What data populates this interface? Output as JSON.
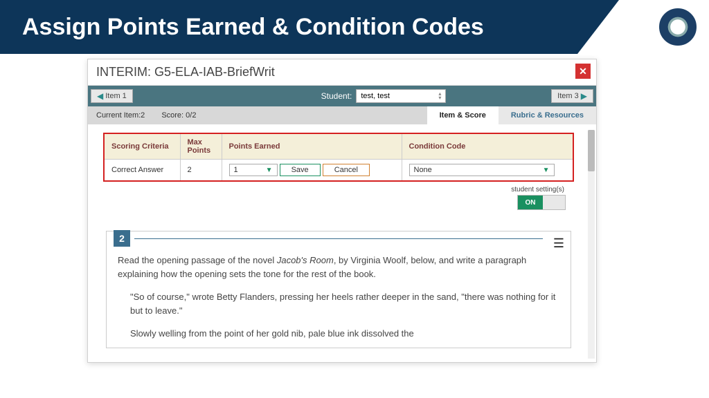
{
  "slide": {
    "title": "Assign Points Earned & Condition Codes"
  },
  "panel": {
    "title": "INTERIM: G5-ELA-IAB-BriefWrit",
    "close": "✕"
  },
  "nav": {
    "prev": "Item 1",
    "next": "Item 3",
    "studentLabel": "Student:",
    "studentValue": "test, test"
  },
  "info": {
    "currentItem": "Current Item:2",
    "score": "Score: 0/2"
  },
  "tabs": {
    "active": "Item & Score",
    "inactive": "Rubric & Resources"
  },
  "table": {
    "headers": {
      "criteria": "Scoring Criteria",
      "max": "Max Points",
      "earned": "Points Earned",
      "condition": "Condition Code"
    },
    "row": {
      "criteria": "Correct Answer",
      "max": "2",
      "earned": "1",
      "save": "Save",
      "cancel": "Cancel",
      "condition": "None"
    }
  },
  "settings": {
    "label": "student setting(s)",
    "on": "ON"
  },
  "item": {
    "num": "2",
    "para1a": "Read the opening passage of the novel ",
    "para1b": "Jacob's Room",
    "para1c": ", by Virginia Woolf, below, and write a paragraph explaining how the opening sets the tone for the rest of the book.",
    "quote": "\"So of course,\" wrote Betty Flanders, pressing her heels rather deeper in the sand, \"there was nothing for it but to leave.\"",
    "para2": "Slowly welling from the point of her gold nib, pale blue ink dissolved the"
  }
}
